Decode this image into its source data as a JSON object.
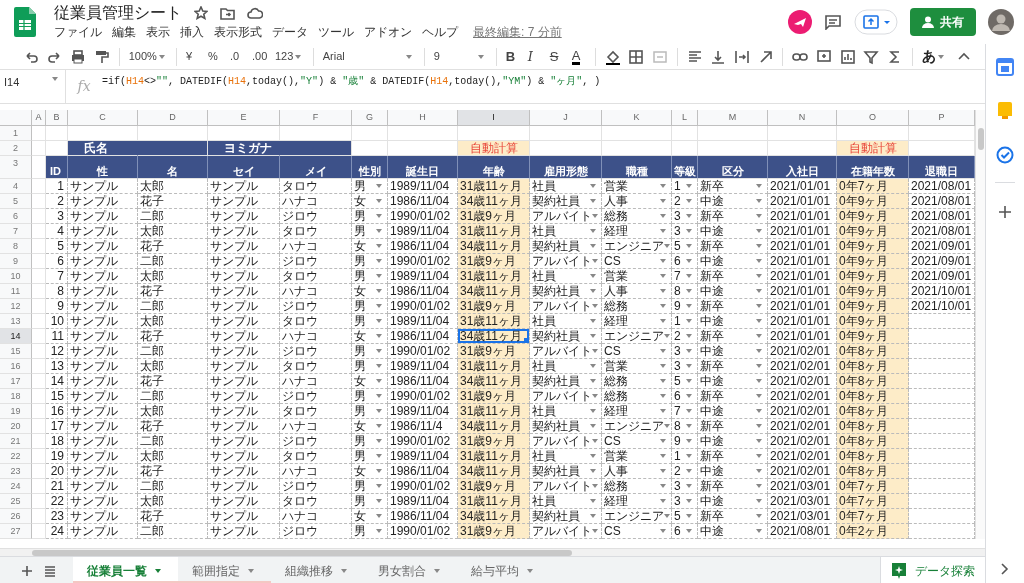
{
  "app": {
    "title": "従業員管理シート",
    "menus": [
      "ファイル",
      "編集",
      "表示",
      "挿入",
      "表示形式",
      "データ",
      "ツール",
      "アドオン",
      "ヘルプ"
    ],
    "last_edit": "最終編集: 7 分前",
    "share": "共有"
  },
  "toolbar": {
    "zoom": "100%",
    "currency": "¥",
    "percent": "%",
    "decimal_decrease": ".0",
    "decimal_increase": ".00",
    "number_format": "123",
    "font": "Arial",
    "font_size": "9",
    "bold": "B",
    "italic": "I",
    "strikethrough": "S",
    "text_color": "A",
    "input_mode": "あ"
  },
  "formula_bar": {
    "cell_ref": "I14",
    "fx_label": "fx",
    "formula": [
      {
        "kind": "plain",
        "text": "=if("
      },
      {
        "kind": "ref",
        "text": "H14"
      },
      {
        "kind": "plain",
        "text": "<>"
      },
      {
        "kind": "string",
        "text": "\"\""
      },
      {
        "kind": "plain",
        "text": ", DATEDIF("
      },
      {
        "kind": "ref",
        "text": "H14"
      },
      {
        "kind": "plain",
        "text": ",today(),"
      },
      {
        "kind": "string",
        "text": "\"Y\""
      },
      {
        "kind": "plain",
        "text": ") & "
      },
      {
        "kind": "string",
        "text": "\"歳\""
      },
      {
        "kind": "plain",
        "text": " & DATEDIF("
      },
      {
        "kind": "ref",
        "text": "H14"
      },
      {
        "kind": "plain",
        "text": ",today(),"
      },
      {
        "kind": "string",
        "text": "\"YM\""
      },
      {
        "kind": "plain",
        "text": ") & "
      },
      {
        "kind": "string",
        "text": "\"ヶ月\""
      },
      {
        "kind": "plain",
        "text": ", )"
      }
    ]
  },
  "sheet": {
    "column_letters": [
      "A",
      "B",
      "C",
      "D",
      "E",
      "F",
      "G",
      "H",
      "I",
      "J",
      "K",
      "L",
      "M",
      "N",
      "O",
      "P"
    ],
    "row_numbers": [
      "1",
      "2",
      "3",
      "4",
      "5",
      "6",
      "7",
      "8",
      "9",
      "10",
      "11",
      "12",
      "13",
      "14",
      "15",
      "16",
      "17",
      "18",
      "19",
      "20",
      "21",
      "22",
      "23",
      "24",
      "25",
      "26",
      "27"
    ],
    "band_row": [
      {
        "kind": "blank"
      },
      {
        "kind": "band",
        "text": "氏名"
      },
      {
        "kind": "band"
      },
      {
        "kind": "band",
        "text": "ヨミガナ"
      },
      {
        "kind": "band"
      },
      {
        "kind": "blank"
      },
      {
        "kind": "blank"
      },
      {
        "kind": "auto",
        "text": "自動計算"
      },
      {
        "kind": "blank"
      },
      {
        "kind": "blank"
      },
      {
        "kind": "blank"
      },
      {
        "kind": "blank"
      },
      {
        "kind": "blank"
      },
      {
        "kind": "auto",
        "text": "自動計算"
      },
      {
        "kind": "blank"
      }
    ],
    "columns": [
      {
        "header": "ID",
        "kind": "id"
      },
      {
        "header": "性",
        "kind": "text"
      },
      {
        "header": "名",
        "kind": "text"
      },
      {
        "header": "セイ",
        "kind": "text"
      },
      {
        "header": "メイ",
        "kind": "text"
      },
      {
        "header": "性別",
        "kind": "dropdown"
      },
      {
        "header": "誕生日",
        "kind": "text"
      },
      {
        "header": "年齢",
        "kind": "auto"
      },
      {
        "header": "雇用形態",
        "kind": "dropdown"
      },
      {
        "header": "職種",
        "kind": "dropdown"
      },
      {
        "header": "等級",
        "kind": "dropdown"
      },
      {
        "header": "区分",
        "kind": "dropdown"
      },
      {
        "header": "入社日",
        "kind": "text"
      },
      {
        "header": "在籍年数",
        "kind": "auto"
      },
      {
        "header": "退職日",
        "kind": "text"
      }
    ],
    "rows": [
      {
        "selected": false,
        "cells": [
          "1",
          "サンプル",
          "太郎",
          "サンプル",
          "タロウ",
          "男",
          "1989/11/04",
          "31歳11ヶ月",
          "社員",
          "営業",
          "1",
          "新卒",
          "2021/01/01",
          "0年7ヶ月",
          "2021/08/01"
        ]
      },
      {
        "selected": false,
        "cells": [
          "2",
          "サンプル",
          "花子",
          "サンプル",
          "ハナコ",
          "女",
          "1986/11/04",
          "34歳11ヶ月",
          "契約社員",
          "人事",
          "2",
          "中途",
          "2021/01/01",
          "0年9ヶ月",
          "2021/08/01"
        ]
      },
      {
        "selected": false,
        "cells": [
          "3",
          "サンプル",
          "二郎",
          "サンプル",
          "ジロウ",
          "男",
          "1990/01/02",
          "31歳9ヶ月",
          "アルバイト",
          "総務",
          "3",
          "新卒",
          "2021/01/01",
          "0年9ヶ月",
          "2021/08/01"
        ]
      },
      {
        "selected": false,
        "cells": [
          "4",
          "サンプル",
          "太郎",
          "サンプル",
          "タロウ",
          "男",
          "1989/11/04",
          "31歳11ヶ月",
          "社員",
          "経理",
          "3",
          "中途",
          "2021/01/01",
          "0年9ヶ月",
          "2021/08/01"
        ]
      },
      {
        "selected": false,
        "cells": [
          "5",
          "サンプル",
          "花子",
          "サンプル",
          "ハナコ",
          "女",
          "1986/11/04",
          "34歳11ヶ月",
          "契約社員",
          "エンジニア",
          "5",
          "新卒",
          "2021/01/01",
          "0年9ヶ月",
          "2021/09/01"
        ]
      },
      {
        "selected": false,
        "cells": [
          "6",
          "サンプル",
          "二郎",
          "サンプル",
          "ジロウ",
          "男",
          "1990/01/02",
          "31歳9ヶ月",
          "アルバイト",
          "CS",
          "6",
          "中途",
          "2021/01/01",
          "0年9ヶ月",
          "2021/09/01"
        ]
      },
      {
        "selected": false,
        "cells": [
          "7",
          "サンプル",
          "太郎",
          "サンプル",
          "タロウ",
          "男",
          "1989/11/04",
          "31歳11ヶ月",
          "社員",
          "営業",
          "7",
          "新卒",
          "2021/01/01",
          "0年9ヶ月",
          "2021/09/01"
        ]
      },
      {
        "selected": false,
        "cells": [
          "8",
          "サンプル",
          "花子",
          "サンプル",
          "ハナコ",
          "女",
          "1986/11/04",
          "34歳11ヶ月",
          "契約社員",
          "人事",
          "8",
          "中途",
          "2021/01/01",
          "0年9ヶ月",
          "2021/10/01"
        ]
      },
      {
        "selected": false,
        "cells": [
          "9",
          "サンプル",
          "二郎",
          "サンプル",
          "ジロウ",
          "男",
          "1990/01/02",
          "31歳9ヶ月",
          "アルバイト",
          "総務",
          "9",
          "新卒",
          "2021/01/01",
          "0年9ヶ月",
          "2021/10/01"
        ]
      },
      {
        "selected": false,
        "cells": [
          "10",
          "サンプル",
          "太郎",
          "サンプル",
          "タロウ",
          "男",
          "1989/11/04",
          "31歳11ヶ月",
          "社員",
          "経理",
          "1",
          "中途",
          "2021/01/01",
          "0年9ヶ月"
        ]
      },
      {
        "selected": true,
        "cells": [
          "11",
          "サンプル",
          "花子",
          "サンプル",
          "ハナコ",
          "女",
          "1986/11/04",
          "34歳11ヶ月",
          "契約社員",
          "エンジニア",
          "2",
          "新卒",
          "2021/01/01",
          "0年9ヶ月"
        ]
      },
      {
        "selected": false,
        "cells": [
          "12",
          "サンプル",
          "二郎",
          "サンプル",
          "ジロウ",
          "男",
          "1990/01/02",
          "31歳9ヶ月",
          "アルバイト",
          "CS",
          "3",
          "中途",
          "2021/02/01",
          "0年8ヶ月"
        ]
      },
      {
        "selected": false,
        "cells": [
          "13",
          "サンプル",
          "太郎",
          "サンプル",
          "タロウ",
          "男",
          "1989/11/04",
          "31歳11ヶ月",
          "社員",
          "営業",
          "3",
          "新卒",
          "2021/02/01",
          "0年8ヶ月"
        ]
      },
      {
        "selected": false,
        "cells": [
          "14",
          "サンプル",
          "花子",
          "サンプル",
          "ハナコ",
          "女",
          "1986/11/04",
          "34歳11ヶ月",
          "契約社員",
          "総務",
          "5",
          "中途",
          "2021/02/01",
          "0年8ヶ月"
        ]
      },
      {
        "selected": false,
        "cells": [
          "15",
          "サンプル",
          "二郎",
          "サンプル",
          "ジロウ",
          "男",
          "1990/01/02",
          "31歳9ヶ月",
          "アルバイト",
          "総務",
          "6",
          "新卒",
          "2021/02/01",
          "0年8ヶ月"
        ]
      },
      {
        "selected": false,
        "cells": [
          "16",
          "サンプル",
          "太郎",
          "サンプル",
          "タロウ",
          "男",
          "1989/11/04",
          "31歳11ヶ月",
          "社員",
          "経理",
          "7",
          "中途",
          "2021/02/01",
          "0年8ヶ月"
        ]
      },
      {
        "selected": false,
        "cells": [
          "17",
          "サンプル",
          "花子",
          "サンプル",
          "ハナコ",
          "女",
          "1986/11/4",
          "34歳11ヶ月",
          "契約社員",
          "エンジニア",
          "8",
          "新卒",
          "2021/02/01",
          "0年8ヶ月"
        ]
      },
      {
        "selected": false,
        "cells": [
          "18",
          "サンプル",
          "二郎",
          "サンプル",
          "ジロウ",
          "男",
          "1990/01/02",
          "31歳9ヶ月",
          "アルバイト",
          "CS",
          "9",
          "中途",
          "2021/02/01",
          "0年8ヶ月"
        ]
      },
      {
        "selected": false,
        "cells": [
          "19",
          "サンプル",
          "太郎",
          "サンプル",
          "タロウ",
          "男",
          "1989/11/04",
          "31歳11ヶ月",
          "社員",
          "営業",
          "1",
          "新卒",
          "2021/02/01",
          "0年8ヶ月"
        ]
      },
      {
        "selected": false,
        "cells": [
          "20",
          "サンプル",
          "花子",
          "サンプル",
          "ハナコ",
          "女",
          "1986/11/04",
          "34歳11ヶ月",
          "契約社員",
          "人事",
          "2",
          "中途",
          "2021/02/01",
          "0年8ヶ月"
        ]
      },
      {
        "selected": false,
        "cells": [
          "21",
          "サンプル",
          "二郎",
          "サンプル",
          "ジロウ",
          "男",
          "1990/01/02",
          "31歳9ヶ月",
          "アルバイト",
          "総務",
          "3",
          "新卒",
          "2021/03/01",
          "0年7ヶ月"
        ]
      },
      {
        "selected": false,
        "cells": [
          "22",
          "サンプル",
          "太郎",
          "サンプル",
          "タロウ",
          "男",
          "1989/11/04",
          "31歳11ヶ月",
          "社員",
          "経理",
          "3",
          "中途",
          "2021/03/01",
          "0年7ヶ月"
        ]
      },
      {
        "selected": false,
        "cells": [
          "23",
          "サンプル",
          "花子",
          "サンプル",
          "ハナコ",
          "女",
          "1986/11/04",
          "34歳11ヶ月",
          "契約社員",
          "エンジニア",
          "5",
          "新卒",
          "2021/03/01",
          "0年7ヶ月"
        ]
      },
      {
        "selected": false,
        "cells": [
          "24",
          "サンプル",
          "二郎",
          "サンプル",
          "ジロウ",
          "男",
          "1990/01/02",
          "31歳9ヶ月",
          "アルバイト",
          "CS",
          "6",
          "中途",
          "2021/08/01",
          "0年2ヶ月"
        ]
      }
    ]
  },
  "tabs": [
    {
      "label": "従業員一覧",
      "selected": true,
      "color": "#f4c7c3"
    },
    {
      "label": "範囲指定",
      "selected": false,
      "color": "#f4c7c3"
    },
    {
      "label": "組織推移",
      "selected": false
    },
    {
      "label": "男女割合",
      "selected": false
    },
    {
      "label": "給与平均",
      "selected": false
    }
  ],
  "explore": "データ探索"
}
